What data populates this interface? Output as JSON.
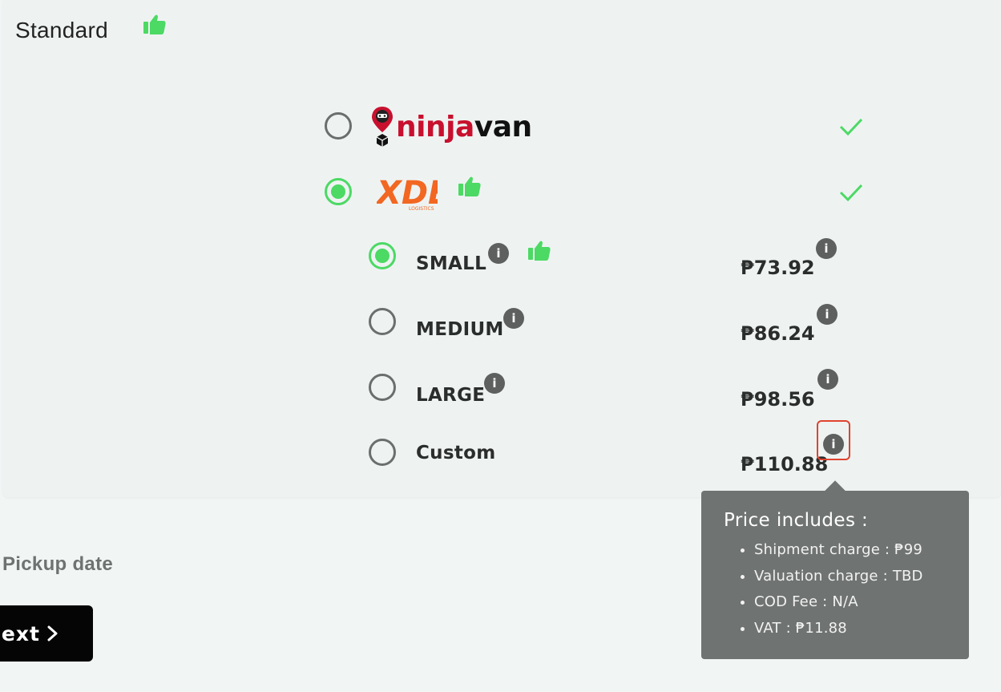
{
  "section": {
    "title": "Standard"
  },
  "couriers": [
    {
      "name_part1": "ninja",
      "name_part2": "van",
      "selected": false,
      "available": true,
      "recommended": false
    },
    {
      "logo_text": "XDE",
      "logo_subtext": "LOGISTICS",
      "selected": true,
      "available": true,
      "recommended": true
    }
  ],
  "sizes": [
    {
      "label": "SMALL",
      "price": "₱73.92",
      "selected": true,
      "recommended": true
    },
    {
      "label": "MEDIUM",
      "price": "₱86.24",
      "selected": false,
      "recommended": false
    },
    {
      "label": "LARGE",
      "price": "₱98.56",
      "selected": false,
      "recommended": false
    },
    {
      "label": "Custom",
      "price": "₱110.88",
      "selected": false,
      "recommended": false
    }
  ],
  "info_glyph": "i",
  "tooltip": {
    "title": "Price includes :",
    "items": [
      "Shipment charge : ₱99",
      "Valuation charge : TBD",
      "COD Fee : N/A",
      "VAT : ₱11.88"
    ]
  },
  "pickup": {
    "label": "Pickup date"
  },
  "next_button": {
    "label": "Next"
  },
  "colors": {
    "accent_green": "#4cd964",
    "ninja_red": "#c8102e",
    "xde_orange": "#f26722",
    "tooltip_bg": "#6f7371",
    "highlight_red": "#e0432f"
  }
}
